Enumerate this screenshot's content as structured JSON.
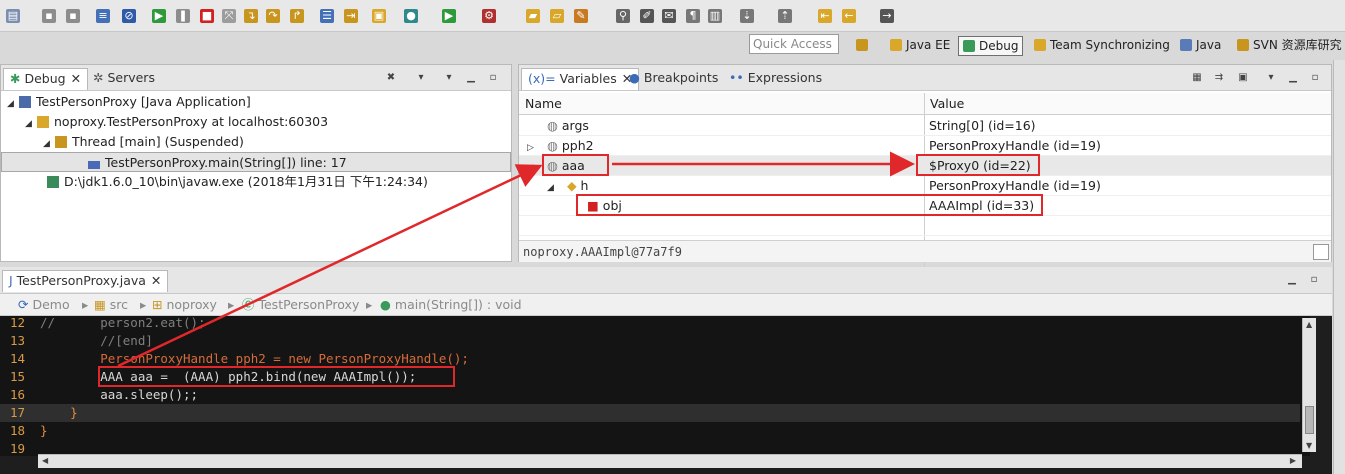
{
  "toolbar": {
    "quick_access_placeholder": "Quick Access",
    "perspectives": [
      "Java EE",
      "Debug",
      "Team Synchronizing",
      "Java",
      "SVN 资源库研究"
    ]
  },
  "debug_view": {
    "tabs": [
      "Debug",
      "Servers"
    ],
    "rows": [
      "TestPersonProxy [Java Application]",
      "noproxy.TestPersonProxy at localhost:60303",
      "Thread [main] (Suspended)",
      "TestPersonProxy.main(String[]) line: 17",
      "D:\\jdk1.6.0_10\\bin\\javaw.exe (2018年1月31日 下午1:24:34)"
    ]
  },
  "variables_view": {
    "tabs": [
      "Variables",
      "Breakpoints",
      "Expressions"
    ],
    "columns": [
      "Name",
      "Value"
    ],
    "rows": [
      {
        "name": "args",
        "value": "String[0]  (id=16)"
      },
      {
        "name": "pph2",
        "value": "PersonProxyHandle  (id=19)"
      },
      {
        "name": "aaa",
        "value": "$Proxy0  (id=22)"
      },
      {
        "name": "h",
        "value": "PersonProxyHandle  (id=19)"
      },
      {
        "name": "obj",
        "value": "AAAImpl  (id=33)"
      }
    ],
    "detail": "noproxy.AAAImpl@77a7f9"
  },
  "editor": {
    "tab": "TestPersonProxy.java",
    "breadcrumbs": [
      "Demo",
      "src",
      "noproxy",
      "TestPersonProxy",
      "main(String[]) : void"
    ],
    "lines": [
      {
        "num": "12",
        "text": "//      person2.eat();"
      },
      {
        "num": "13",
        "text": "        //[end]"
      },
      {
        "num": "14",
        "text": "        PersonProxyHandle pph2 = new PersonProxyHandle();"
      },
      {
        "num": "15",
        "text": "        AAA aaa =  (AAA) pph2.bind(new AAAImpl());"
      },
      {
        "num": "16",
        "text": "        aaa.sleep();;"
      },
      {
        "num": "17",
        "text": "    }"
      },
      {
        "num": "18",
        "text": "}"
      },
      {
        "num": "19",
        "text": ""
      }
    ]
  },
  "colors": {
    "accent_red": "#e0282b",
    "editor_bg": "#141414"
  }
}
